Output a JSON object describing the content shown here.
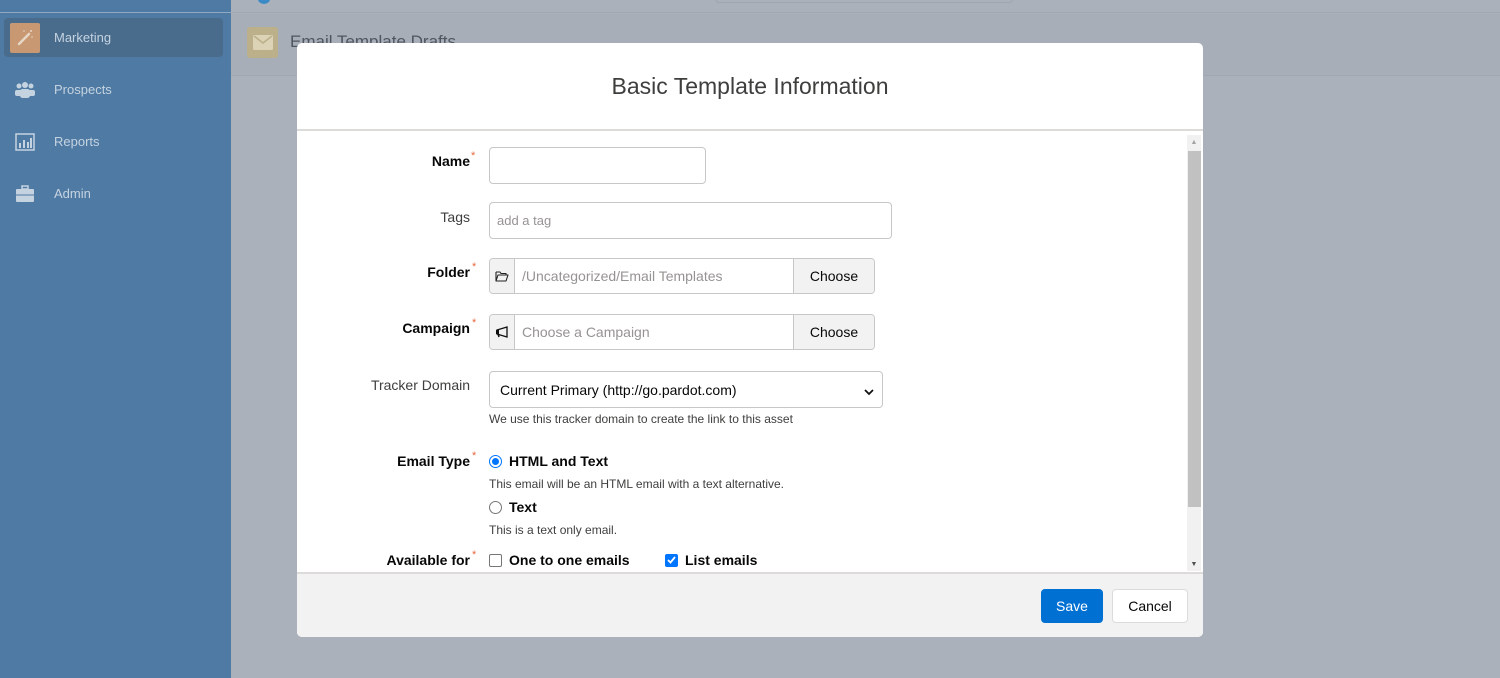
{
  "sidebar": {
    "items": [
      {
        "label": "Marketing",
        "icon": "magic-wand-icon",
        "active": true
      },
      {
        "label": "Prospects",
        "icon": "people-icon",
        "active": false
      },
      {
        "label": "Reports",
        "icon": "bar-chart-icon",
        "active": false
      },
      {
        "label": "Admin",
        "icon": "briefcase-icon",
        "active": false
      }
    ]
  },
  "background_page": {
    "title": "Email Template Drafts",
    "icon": "envelope-icon"
  },
  "modal": {
    "title": "Basic Template Information",
    "fields": {
      "name": {
        "label": "Name",
        "required": true,
        "value": ""
      },
      "tags": {
        "label": "Tags",
        "required": false,
        "placeholder": "add a tag"
      },
      "folder": {
        "label": "Folder",
        "required": true,
        "value": "/Uncategorized/Email Templates",
        "icon": "folder-open-icon",
        "button": "Choose"
      },
      "campaign": {
        "label": "Campaign",
        "required": true,
        "placeholder": "Choose a Campaign",
        "icon": "megaphone-icon",
        "button": "Choose"
      },
      "tracker_domain": {
        "label": "Tracker Domain",
        "selected": "Current Primary (http://go.pardot.com)",
        "help": "We use this tracker domain to create the link to this asset"
      },
      "email_type": {
        "label": "Email Type",
        "required": true,
        "options": [
          {
            "label": "HTML and Text",
            "description": "This email will be an HTML email with a text alternative.",
            "selected": true
          },
          {
            "label": "Text",
            "description": "This is a text only email.",
            "selected": false
          }
        ]
      },
      "available_for": {
        "label": "Available for",
        "required": true,
        "options": [
          {
            "label": "One to one emails",
            "checked": false
          },
          {
            "label": "List emails",
            "checked": true
          }
        ]
      }
    },
    "required_marker": "*",
    "buttons": {
      "save": "Save",
      "cancel": "Cancel"
    }
  },
  "colors": {
    "sidebar": "#4f7aa3",
    "primary_button": "#0070d2",
    "required": "#e6693f",
    "overlay": "#aab1bb"
  }
}
